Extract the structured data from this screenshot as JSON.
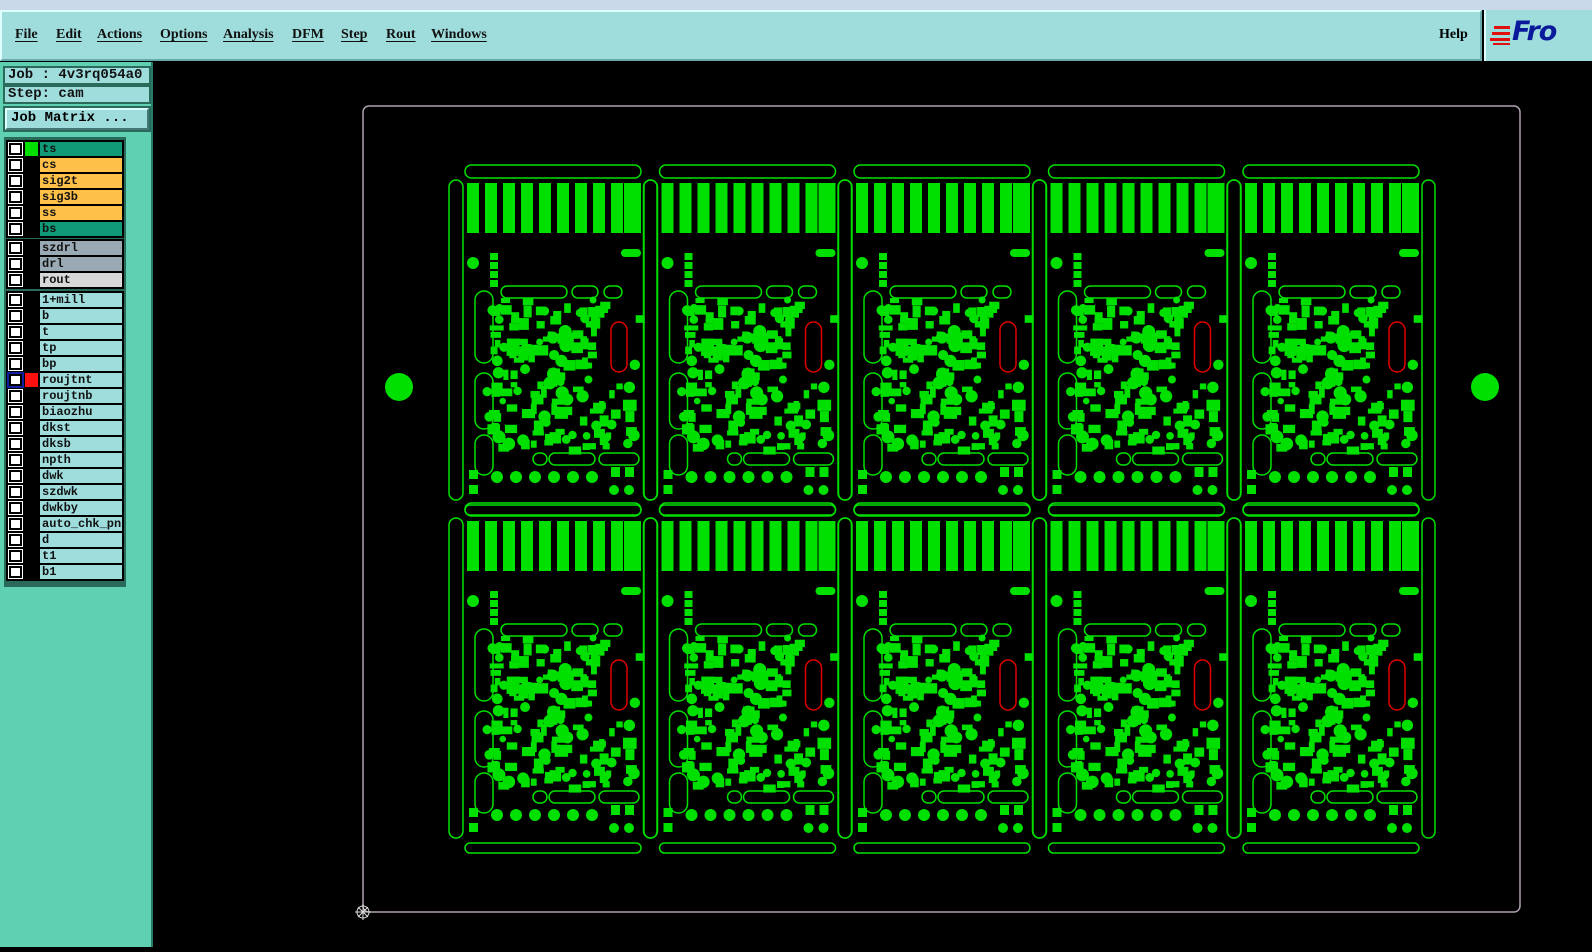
{
  "menubar": {
    "items": [
      "File",
      "Edit",
      "Actions",
      "Options",
      "Analysis",
      "DFM",
      "Step",
      "Rout",
      "Windows"
    ],
    "help": "Help"
  },
  "logo": {
    "text": "Fro"
  },
  "job": {
    "job_label": "Job : 4v3rq054a0",
    "step_label": "Step: cam",
    "matrix_button": "Job Matrix ..."
  },
  "colors": {
    "board": "#00e000",
    "rout": "#e00000",
    "panel_border": "#b0a0b0"
  },
  "layers": [
    {
      "group": 0,
      "name": "ts",
      "bg": "#109a78",
      "swatch": "#00e000"
    },
    {
      "group": 0,
      "name": "cs",
      "bg": "#ffc04a"
    },
    {
      "group": 0,
      "name": "sig2t",
      "bg": "#ffc04a"
    },
    {
      "group": 0,
      "name": "sig3b",
      "bg": "#ffc04a"
    },
    {
      "group": 0,
      "name": "ss",
      "bg": "#ffc04a"
    },
    {
      "group": 0,
      "name": "bs",
      "bg": "#109a78"
    },
    {
      "group": 1,
      "name": "szdrl",
      "bg": "#9aaab4"
    },
    {
      "group": 1,
      "name": "drl",
      "bg": "#9aaab4"
    },
    {
      "group": 1,
      "name": "rout",
      "bg": "#d8d8d8"
    },
    {
      "group": 2,
      "name": "1+mill",
      "bg": "#9fdcdc"
    },
    {
      "group": 2,
      "name": "b",
      "bg": "#9fdcdc"
    },
    {
      "group": 2,
      "name": "t",
      "bg": "#9fdcdc"
    },
    {
      "group": 2,
      "name": "tp",
      "bg": "#9fdcdc"
    },
    {
      "group": 2,
      "name": "bp",
      "bg": "#9fdcdc"
    },
    {
      "group": 2,
      "name": "roujtnt",
      "bg": "#9fdcdc",
      "swatch": "#ff1010",
      "selected": true
    },
    {
      "group": 2,
      "name": "roujtnb",
      "bg": "#9fdcdc"
    },
    {
      "group": 2,
      "name": "biaozhu",
      "bg": "#9fdcdc"
    },
    {
      "group": 2,
      "name": "dkst",
      "bg": "#9fdcdc"
    },
    {
      "group": 2,
      "name": "dksb",
      "bg": "#9fdcdc"
    },
    {
      "group": 2,
      "name": "npth",
      "bg": "#9fdcdc"
    },
    {
      "group": 2,
      "name": "dwk",
      "bg": "#9fdcdc"
    },
    {
      "group": 2,
      "name": "szdwk",
      "bg": "#9fdcdc"
    },
    {
      "group": 2,
      "name": "dwkby",
      "bg": "#9fdcdc"
    },
    {
      "group": 2,
      "name": "auto_chk_pnl",
      "bg": "#9fdcdc"
    },
    {
      "group": 2,
      "name": "d",
      "bg": "#9fdcdc"
    },
    {
      "group": 2,
      "name": "t1",
      "bg": "#9fdcdc"
    },
    {
      "group": 2,
      "name": "b1",
      "bg": "#9fdcdc"
    }
  ],
  "panel": {
    "columns": 5,
    "rows": 2
  }
}
